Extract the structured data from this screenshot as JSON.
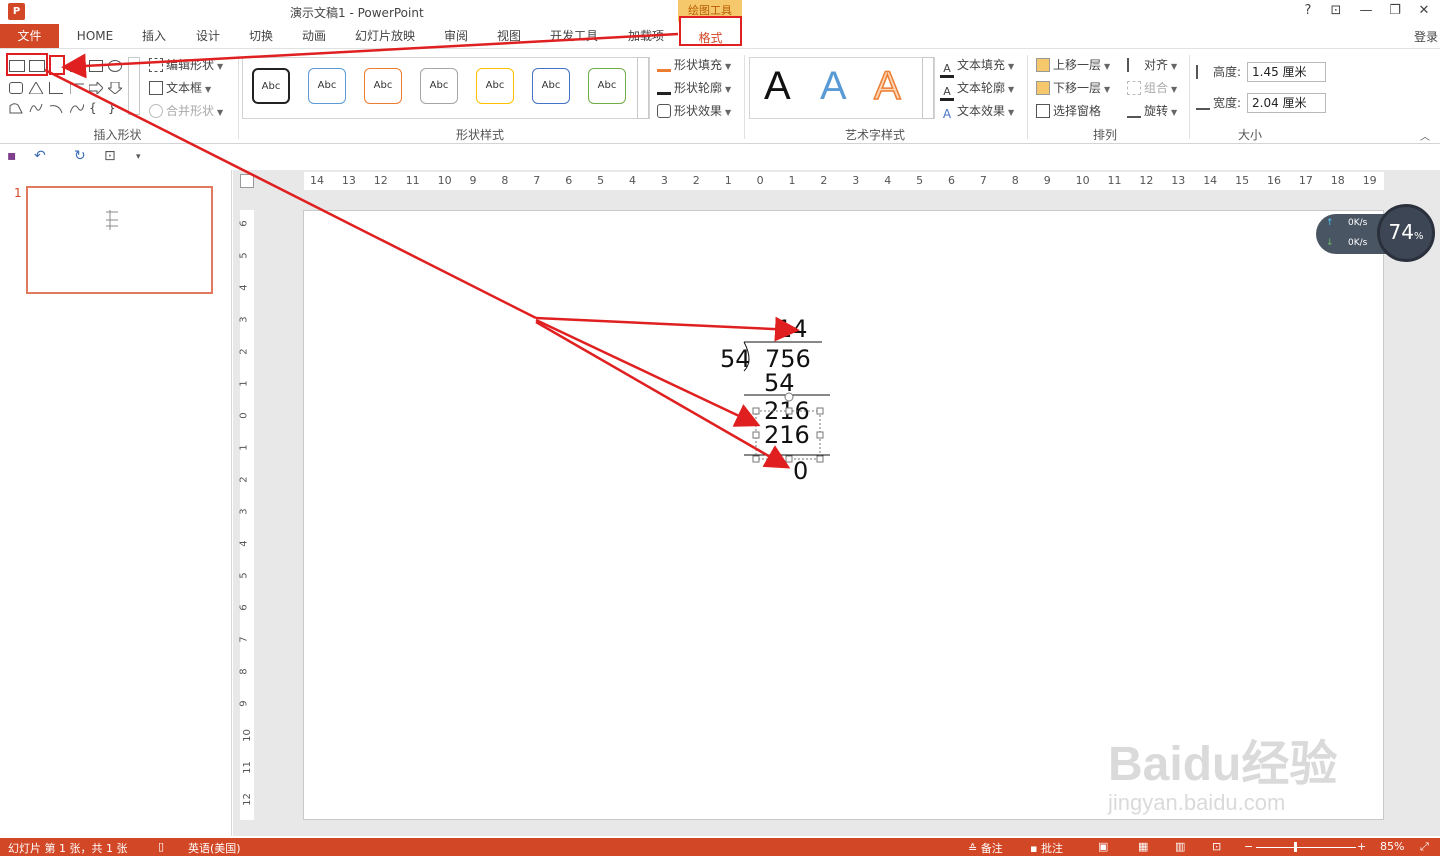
{
  "window": {
    "app_icon": "P",
    "title": "演示文稿1 - PowerPoint",
    "context_tool_label": "绘图工具",
    "help": "?",
    "ribbon_display": "⊡",
    "minimize": "—",
    "restore": "❐",
    "close": "✕"
  },
  "tabs": [
    {
      "label": "文件"
    },
    {
      "label": "HOME"
    },
    {
      "label": "插入"
    },
    {
      "label": "设计"
    },
    {
      "label": "切换"
    },
    {
      "label": "动画"
    },
    {
      "label": "幻灯片放映"
    },
    {
      "label": "审阅"
    },
    {
      "label": "视图"
    },
    {
      "label": "开发工具"
    },
    {
      "label": "加载项"
    },
    {
      "label": "格式"
    }
  ],
  "login": "登录",
  "ribbon": {
    "insert_shapes": {
      "label": "插入形状",
      "edit_shape": "编辑形状",
      "text_box": "文本框",
      "merge_shapes": "合并形状"
    },
    "shape_styles": {
      "label": "形状样式",
      "samples": [
        {
          "text": "Abc",
          "color": "#222222"
        },
        {
          "text": "Abc",
          "color": "#5b9bd5"
        },
        {
          "text": "Abc",
          "color": "#ed7d31"
        },
        {
          "text": "Abc",
          "color": "#a5a5a5"
        },
        {
          "text": "Abc",
          "color": "#ffc000"
        },
        {
          "text": "Abc",
          "color": "#4472c4"
        },
        {
          "text": "Abc",
          "color": "#70ad47"
        }
      ],
      "fill": "形状填充",
      "outline": "形状轮廓",
      "effect": "形状效果"
    },
    "wordart": {
      "label": "艺术字样式",
      "letters": [
        "A",
        "A",
        "A"
      ],
      "text_fill": "文本填充",
      "text_outline": "文本轮廓",
      "text_effect": "文本效果"
    },
    "arrange": {
      "label": "排列",
      "bring_forward": "上移一层",
      "send_backward": "下移一层",
      "selection_pane": "选择窗格",
      "align": "对齐",
      "group": "组合",
      "rotate": "旋转"
    },
    "size": {
      "label": "大小",
      "height_label": "高度:",
      "height_value": "1.45 厘米",
      "width_label": "宽度:",
      "width_value": "2.04 厘米"
    }
  },
  "thumbnails": {
    "slide_number": "1"
  },
  "ruler": {
    "h_ticks": [
      "14",
      "13",
      "12",
      "11",
      "10",
      "9",
      "8",
      "7",
      "6",
      "5",
      "4",
      "3",
      "2",
      "1",
      "0",
      "1",
      "2",
      "3",
      "4",
      "5",
      "6",
      "7",
      "8",
      "9",
      "10",
      "11",
      "12",
      "13",
      "14",
      "15",
      "16",
      "17",
      "18",
      "19"
    ],
    "v_ticks": [
      "6",
      "5",
      "4",
      "3",
      "2",
      "1",
      "0",
      "1",
      "2",
      "3",
      "4",
      "5",
      "6",
      "7",
      "8",
      "9",
      "10",
      "11",
      "12"
    ]
  },
  "slide": {
    "quotient": "14",
    "divisor": "54",
    "dividend": "756",
    "step1": "54",
    "remainder1": "216",
    "step2": "216",
    "remainder": "0"
  },
  "net_widget": {
    "up_speed": "0K/s",
    "down_speed": "0K/s",
    "percent": "74",
    "percent_sign": "%"
  },
  "watermark": {
    "brand": "Bai",
    "brand2": "du",
    "brand3": "经验",
    "url": "jingyan.baidu.com"
  },
  "status": {
    "slide_info": "幻灯片 第 1 张，共 1 张",
    "language": "英语(美国)",
    "notes": "备注",
    "comments": "批注",
    "zoom": "85%"
  },
  "colors": {
    "accent": "#d24726",
    "annotation_red": "#e02020"
  }
}
